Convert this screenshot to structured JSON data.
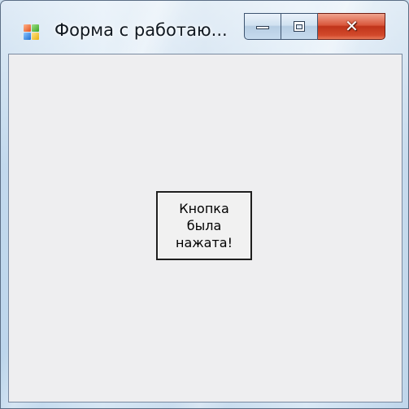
{
  "window": {
    "title": "Форма с работаю...",
    "icon": "windows-form-app-icon",
    "caption_buttons": {
      "minimize_icon": "minimize-icon",
      "maximize_icon": "maximize-icon",
      "close_icon": "close-icon",
      "close_glyph": "✕"
    },
    "colors": {
      "frame": "#c9dcec",
      "client_background": "#eeeef0",
      "close_button": "#c0341a"
    }
  },
  "form": {
    "button_label": "Кнопка\nбыла\nнажата!"
  }
}
